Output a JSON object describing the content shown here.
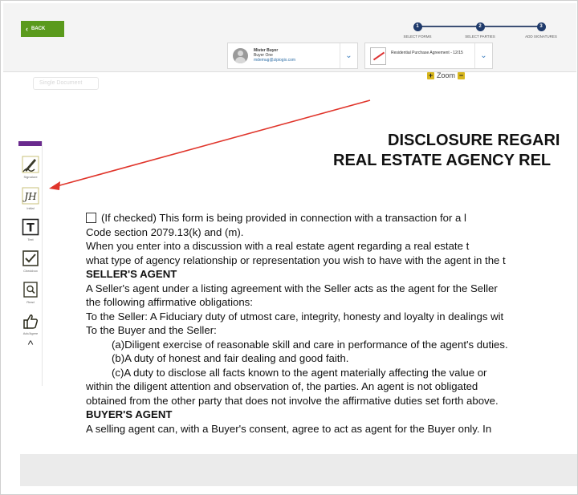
{
  "header": {
    "back_label": "BACK",
    "steps": [
      {
        "number": "1",
        "label": "SELECT FORMS"
      },
      {
        "number": "2",
        "label": "SELECT PARTIES"
      },
      {
        "number": "3",
        "label": "ADD SIGNATURES"
      }
    ],
    "party": {
      "name": "Mister Buyer",
      "role": "Buyer One",
      "email": "mdemug@zipiogix.com"
    },
    "document": {
      "name": "Residential Purchase Agreement - 12/15"
    },
    "zoom_label": "Zoom",
    "zoom_in": "+",
    "zoom_out": "−",
    "single_document_placeholder": "Single Document"
  },
  "toolbar": {
    "items": [
      {
        "label": "Signature",
        "icon": "signature-pen-icon"
      },
      {
        "label": "Initial",
        "icon": "initials-icon"
      },
      {
        "label": "Text",
        "icon": "text-t-icon"
      },
      {
        "label": "Checkbox",
        "icon": "checkbox-icon"
      },
      {
        "label": "Read",
        "icon": "magnifier-doc-icon"
      },
      {
        "label": "Ack/Agree",
        "icon": "thumbs-up-icon"
      }
    ],
    "collapse": "^",
    "initials_glyph": "JH",
    "text_glyph": "T"
  },
  "document_view": {
    "title_line1": "DISCLOSURE REGARI",
    "title_line2": "REAL ESTATE AGENCY REL",
    "lines": [
      "(If checked) This form is being provided in connection with a transaction for a l",
      "Code section 2079.13(k) and (m).",
      "When you enter into a discussion with a real estate agent regarding a real estate t",
      "what type of agency relationship or representation you wish to have with the agent in the t",
      "SELLER'S AGENT",
      "A Seller's agent under a listing agreement with the Seller acts as the agent for the Seller",
      "the following affirmative obligations:",
      "To the Seller: A Fiduciary duty of utmost care, integrity, honesty and loyalty in dealings wit",
      "To the Buyer and the Seller:",
      "(a)Diligent exercise of reasonable skill and care in performance of the agent's duties.",
      "(b)A duty of honest and fair dealing and good faith.",
      "(c)A duty to disclose all facts known to the agent materially affecting the value or",
      "within the diligent attention and observation of, the parties. An agent is not obligated",
      "obtained from the other party that does not involve the affirmative duties set forth above.",
      "BUYER'S AGENT",
      "A selling agent can, with a Buyer's consent, agree to act as agent for the Buyer only. In"
    ]
  },
  "colors": {
    "back_green": "#5a9a1c",
    "step_navy": "#1f3a6b",
    "toolbar_purple": "#6a2a8e",
    "annotation_arrow": "#e0352b",
    "zoom_yellow": "#d8b71e"
  }
}
